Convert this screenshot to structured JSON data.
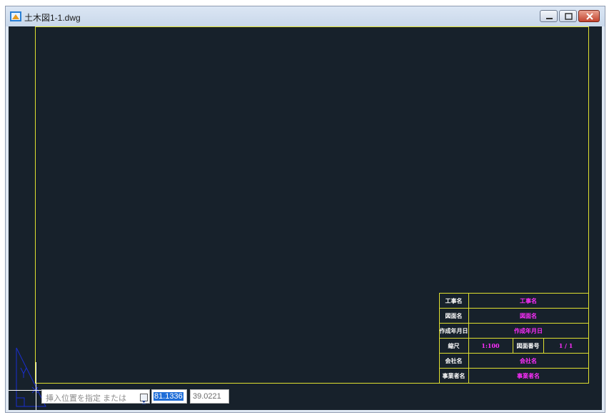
{
  "window": {
    "title": "土木図1-1.dwg",
    "icons": {
      "app": "cad-drawing-icon",
      "minimize": "minimize-icon",
      "maximize": "maximize-icon",
      "close": "close-icon"
    }
  },
  "colors": {
    "canvas_background": "#17212b",
    "border_line": "#e0e030",
    "title_block_label": "#ffffff",
    "title_block_value": "#ff2dff",
    "ucs_icon": "#1a2fd0"
  },
  "title_block": {
    "rows": [
      {
        "label": "工事名",
        "value": "工事名"
      },
      {
        "label": "図面名",
        "value": "図面名"
      },
      {
        "label": "作成年月日",
        "value": "作成年月日"
      },
      {
        "label": "縮尺",
        "value": "1:100",
        "label2": "図面番号",
        "value2": "1 / 1"
      },
      {
        "label": "会社名",
        "value": "会社名"
      },
      {
        "label": "事業者名",
        "value": "事業者名"
      }
    ]
  },
  "command": {
    "prompt": "挿入位置を指定 または",
    "dropdown_icon": "dropdown-arrow-icon",
    "x": "81.1336",
    "y": "39.0221"
  }
}
